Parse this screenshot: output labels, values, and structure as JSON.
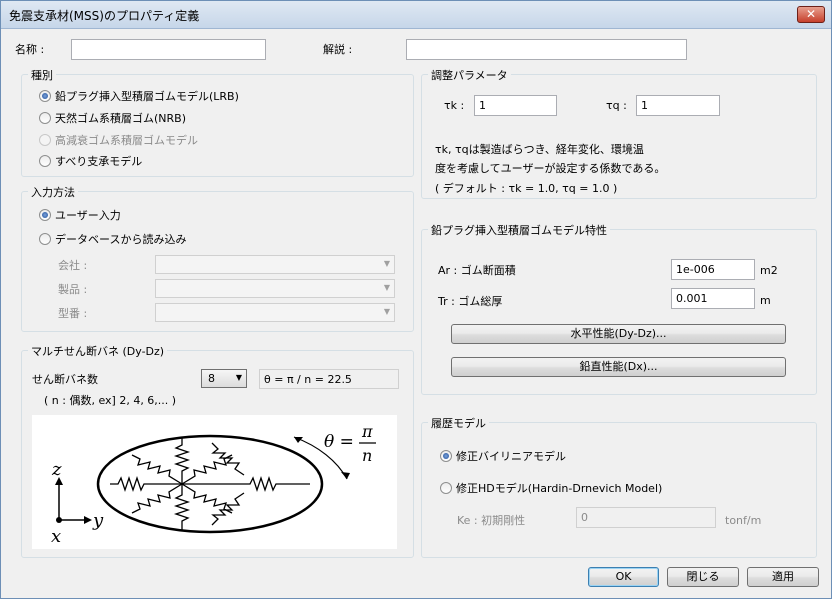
{
  "window": {
    "title": "免震支承材(MSS)のプロパティ定義",
    "close_label": "✕"
  },
  "header": {
    "name_label": "名称 :",
    "name_value": "",
    "desc_label": "解説 :",
    "desc_value": ""
  },
  "type_group": {
    "title": "種別",
    "options": [
      {
        "label": "鉛プラグ挿入型積層ゴムモデル(LRB)",
        "selected": true,
        "disabled": false
      },
      {
        "label": "天然ゴム系積層ゴム(NRB)",
        "selected": false,
        "disabled": false
      },
      {
        "label": "高減衰ゴム系積層ゴムモデル",
        "selected": false,
        "disabled": true
      },
      {
        "label": "すべり支承モデル",
        "selected": false,
        "disabled": false
      }
    ]
  },
  "input_group": {
    "title": "入力方法",
    "options": [
      {
        "label": "ユーザー入力",
        "selected": true
      },
      {
        "label": "データベースから読み込み",
        "selected": false
      }
    ],
    "company_label": "会社 :",
    "product_label": "製品 :",
    "model_label": "型番 :"
  },
  "spring_group": {
    "title": "マルチせん断バネ (Dy-Dz)",
    "count_label": "せん断バネ数",
    "count_value": "8",
    "theta_text": "θ = π / n = 22.5",
    "note": "( n : 偶数, ex] 2, 4, 6,... )",
    "diagram": {
      "theta": "θ =",
      "pi": "π",
      "n": "n",
      "axis_z": "z",
      "axis_y": "y",
      "axis_x": "x"
    }
  },
  "adjust_group": {
    "title": "調整パラメータ",
    "tk_label": "τk :",
    "tk_value": "1",
    "tq_label": "τq :",
    "tq_value": "1",
    "desc_line1": "τk, τqは製造ばらつき、経年変化、環境温",
    "desc_line2": "度を考慮してユーザーが設定する係数である。",
    "desc_line3": "( デフォルト : τk = 1.0, τq = 1.0 )"
  },
  "lrb_group": {
    "title": "鉛プラグ挿入型積層ゴムモデル特性",
    "ar_label": "Ar : ゴム断面積",
    "ar_value": "1e-006",
    "ar_unit": "m2",
    "tr_label": "Tr : ゴム総厚",
    "tr_value": "0.001",
    "tr_unit": "m",
    "horiz_button": "水平性能(Dy-Dz)...",
    "vert_button": "鉛直性能(Dx)..."
  },
  "history_group": {
    "title": "履歴モデル",
    "options": [
      {
        "label": "修正バイリニアモデル",
        "selected": true
      },
      {
        "label": "修正HDモデル(Hardin-Drnevich Model)",
        "selected": false
      }
    ],
    "ke_label": "Ke : 初期剛性",
    "ke_value": "0",
    "ke_unit": "tonf/m"
  },
  "footer": {
    "ok": "OK",
    "close": "閉じる",
    "apply": "適用"
  }
}
